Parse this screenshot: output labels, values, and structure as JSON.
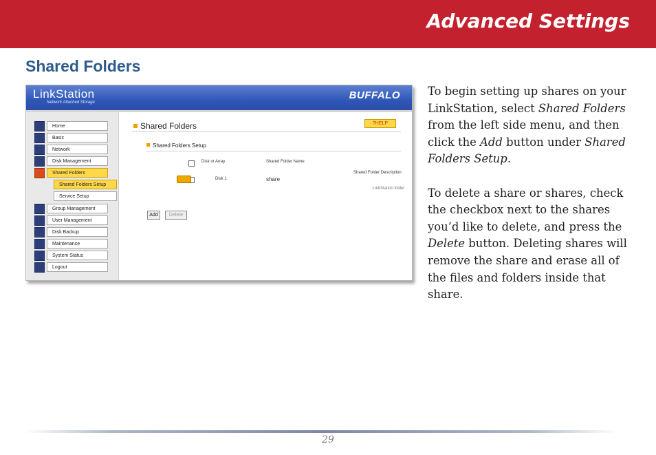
{
  "header": {
    "title": "Advanced Settings"
  },
  "section": {
    "title": "Shared Folders"
  },
  "screenshot": {
    "logo_text": "LinkStation",
    "logo_subtitle": "Network Attached Storage",
    "brand": "BUFFALO",
    "nav": [
      {
        "label": "Home",
        "state": "normal"
      },
      {
        "label": "Basic",
        "state": "normal"
      },
      {
        "label": "Network",
        "state": "normal"
      },
      {
        "label": "Disk Management",
        "state": "normal"
      },
      {
        "label": "Shared Folders",
        "state": "selected"
      },
      {
        "label": "Shared Folders Setup",
        "state": "sub-selected"
      },
      {
        "label": "Service Setup",
        "state": "sub"
      },
      {
        "label": "Group Management",
        "state": "normal"
      },
      {
        "label": "User Management",
        "state": "normal"
      },
      {
        "label": "Disk Backup",
        "state": "normal"
      },
      {
        "label": "Maintenance",
        "state": "normal"
      },
      {
        "label": "System Status",
        "state": "normal"
      },
      {
        "label": "Logout",
        "state": "normal"
      }
    ],
    "page_title": "Shared Folders",
    "help_label": "?HELP",
    "subsection_title": "Shared Folders Setup",
    "columns": {
      "disk": "Disk or Array",
      "name": "Shared Folder Name",
      "description": "Shared Folder Description"
    },
    "row": {
      "disk": "Disk 1",
      "name": "share",
      "description": "LinkStation folder"
    },
    "buttons": {
      "add": "Add",
      "delete": "Delete"
    }
  },
  "body": {
    "para1": [
      {
        "t": "To begin setting up shares on your LinkStation, select "
      },
      {
        "t": "Shared Folders",
        "i": true
      },
      {
        "t": " from the left side menu, and then click the "
      },
      {
        "t": "Add",
        "i": true
      },
      {
        "t": " button under "
      },
      {
        "t": "Shared Folders Setup",
        "i": true
      },
      {
        "t": "."
      }
    ],
    "para2": [
      {
        "t": "To delete a share or shares, check the checkbox next to the shares you’d like to delete, and press the "
      },
      {
        "t": "Delete",
        "i": true
      },
      {
        "t": " button. Deleting shares will remove the share and erase all of the files and folders inside that share."
      }
    ]
  },
  "footer": {
    "page_number": "29"
  }
}
